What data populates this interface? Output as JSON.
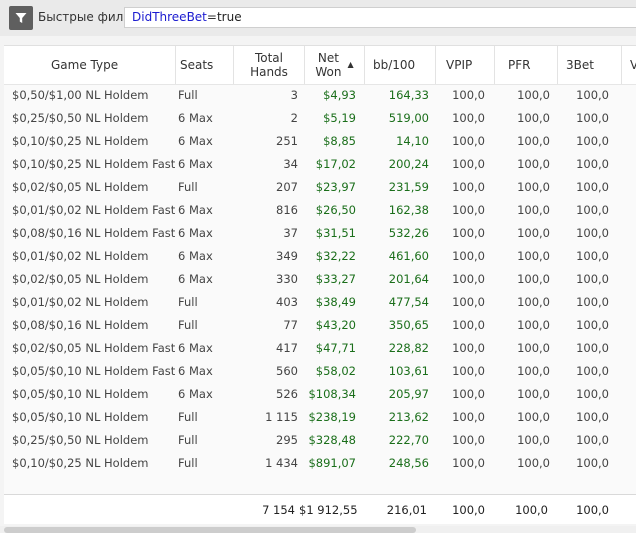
{
  "filter": {
    "label": "Быстрые фильт",
    "query_field": "DidThreeBet",
    "query_op": "=",
    "query_value": "true"
  },
  "columns": {
    "game_type": "Game Type",
    "seats": "Seats",
    "total_hands_1": "Total",
    "total_hands_2": "Hands",
    "net_won_1": "Net",
    "net_won_2": "Won",
    "bb100": "bb/100",
    "vpip": "VPIP",
    "pfr": "PFR",
    "threebet": "3Bet",
    "next": "V"
  },
  "rows": [
    {
      "game": "$0,50/$1,00 NL Holdem",
      "seats": "Full",
      "hands": "3",
      "won": "$4,93",
      "bb": "164,33",
      "vpip": "100,0",
      "pfr": "100,0",
      "tb": "100,0"
    },
    {
      "game": "$0,25/$0,50 NL Holdem",
      "seats": "6 Max",
      "hands": "2",
      "won": "$5,19",
      "bb": "519,00",
      "vpip": "100,0",
      "pfr": "100,0",
      "tb": "100,0"
    },
    {
      "game": "$0,10/$0,25 NL Holdem",
      "seats": "6 Max",
      "hands": "251",
      "won": "$8,85",
      "bb": "14,10",
      "vpip": "100,0",
      "pfr": "100,0",
      "tb": "100,0"
    },
    {
      "game": "$0,10/$0,25 NL Holdem Fast",
      "seats": "6 Max",
      "hands": "34",
      "won": "$17,02",
      "bb": "200,24",
      "vpip": "100,0",
      "pfr": "100,0",
      "tb": "100,0"
    },
    {
      "game": "$0,02/$0,05 NL Holdem",
      "seats": "Full",
      "hands": "207",
      "won": "$23,97",
      "bb": "231,59",
      "vpip": "100,0",
      "pfr": "100,0",
      "tb": "100,0"
    },
    {
      "game": "$0,01/$0,02 NL Holdem Fast",
      "seats": "6 Max",
      "hands": "816",
      "won": "$26,50",
      "bb": "162,38",
      "vpip": "100,0",
      "pfr": "100,0",
      "tb": "100,0"
    },
    {
      "game": "$0,08/$0,16 NL Holdem Fast",
      "seats": "6 Max",
      "hands": "37",
      "won": "$31,51",
      "bb": "532,26",
      "vpip": "100,0",
      "pfr": "100,0",
      "tb": "100,0"
    },
    {
      "game": "$0,01/$0,02 NL Holdem",
      "seats": "6 Max",
      "hands": "349",
      "won": "$32,22",
      "bb": "461,60",
      "vpip": "100,0",
      "pfr": "100,0",
      "tb": "100,0"
    },
    {
      "game": "$0,02/$0,05 NL Holdem",
      "seats": "6 Max",
      "hands": "330",
      "won": "$33,27",
      "bb": "201,64",
      "vpip": "100,0",
      "pfr": "100,0",
      "tb": "100,0"
    },
    {
      "game": "$0,01/$0,02 NL Holdem",
      "seats": "Full",
      "hands": "403",
      "won": "$38,49",
      "bb": "477,54",
      "vpip": "100,0",
      "pfr": "100,0",
      "tb": "100,0"
    },
    {
      "game": "$0,08/$0,16 NL Holdem",
      "seats": "Full",
      "hands": "77",
      "won": "$43,20",
      "bb": "350,65",
      "vpip": "100,0",
      "pfr": "100,0",
      "tb": "100,0"
    },
    {
      "game": "$0,02/$0,05 NL Holdem Fast",
      "seats": "6 Max",
      "hands": "417",
      "won": "$47,71",
      "bb": "228,82",
      "vpip": "100,0",
      "pfr": "100,0",
      "tb": "100,0"
    },
    {
      "game": "$0,05/$0,10 NL Holdem Fast",
      "seats": "6 Max",
      "hands": "560",
      "won": "$58,02",
      "bb": "103,61",
      "vpip": "100,0",
      "pfr": "100,0",
      "tb": "100,0"
    },
    {
      "game": "$0,05/$0,10 NL Holdem",
      "seats": "6 Max",
      "hands": "526",
      "won": "$108,34",
      "bb": "205,97",
      "vpip": "100,0",
      "pfr": "100,0",
      "tb": "100,0"
    },
    {
      "game": "$0,05/$0,10 NL Holdem",
      "seats": "Full",
      "hands": "1 115",
      "won": "$238,19",
      "bb": "213,62",
      "vpip": "100,0",
      "pfr": "100,0",
      "tb": "100,0"
    },
    {
      "game": "$0,25/$0,50 NL Holdem",
      "seats": "Full",
      "hands": "295",
      "won": "$328,48",
      "bb": "222,70",
      "vpip": "100,0",
      "pfr": "100,0",
      "tb": "100,0"
    },
    {
      "game": "$0,10/$0,25 NL Holdem",
      "seats": "Full",
      "hands": "1 434",
      "won": "$891,07",
      "bb": "248,56",
      "vpip": "100,0",
      "pfr": "100,0",
      "tb": "100,0"
    }
  ],
  "totals": {
    "hands": "7 154",
    "won": "$1 912,55",
    "bb": "216,01",
    "vpip": "100,0",
    "pfr": "100,0",
    "tb": "100,0"
  },
  "colors": {
    "positive": "#1a6e1a"
  }
}
